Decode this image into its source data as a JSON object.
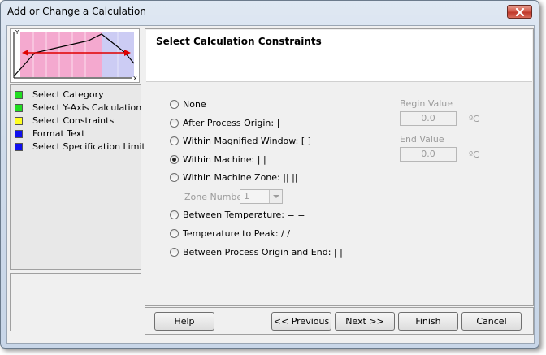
{
  "window": {
    "title": "Add or Change a Calculation"
  },
  "thumbnail": {
    "x_label": "X",
    "y_label": "Y"
  },
  "steps": [
    {
      "label": "Select Category",
      "color": "#22dd22"
    },
    {
      "label": "Select Y-Axis Calculation",
      "color": "#22dd22"
    },
    {
      "label": "Select Constraints",
      "color": "#ffff22"
    },
    {
      "label": "Format Text",
      "color": "#1010ee"
    },
    {
      "label": "Select Specification Limits",
      "color": "#1010ee"
    }
  ],
  "header": {
    "title": "Select Calculation Constraints"
  },
  "constraints": [
    {
      "label": "None",
      "checked": false
    },
    {
      "label": "After Process Origin: |",
      "checked": false
    },
    {
      "label": "Within Magnified Window: [ ]",
      "checked": false
    },
    {
      "label": "Within Machine: |  |",
      "checked": true
    },
    {
      "label": "Within Machine Zone: ||  ||",
      "checked": false
    },
    {
      "label": "Between Temperature: =  =",
      "checked": false
    },
    {
      "label": "Temperature to Peak: /  /",
      "checked": false
    },
    {
      "label": "Between Process Origin and End: |  |",
      "checked": false
    }
  ],
  "zone": {
    "label": "Zone Number",
    "value": "1"
  },
  "begin": {
    "label": "Begin Value",
    "value": "0.0",
    "unit": "ºC"
  },
  "end": {
    "label": "End Value",
    "value": "0.0",
    "unit": "ºC"
  },
  "buttons": {
    "help": "Help",
    "previous": "<< Previous",
    "next": "Next >>",
    "finish": "Finish",
    "cancel": "Cancel"
  }
}
